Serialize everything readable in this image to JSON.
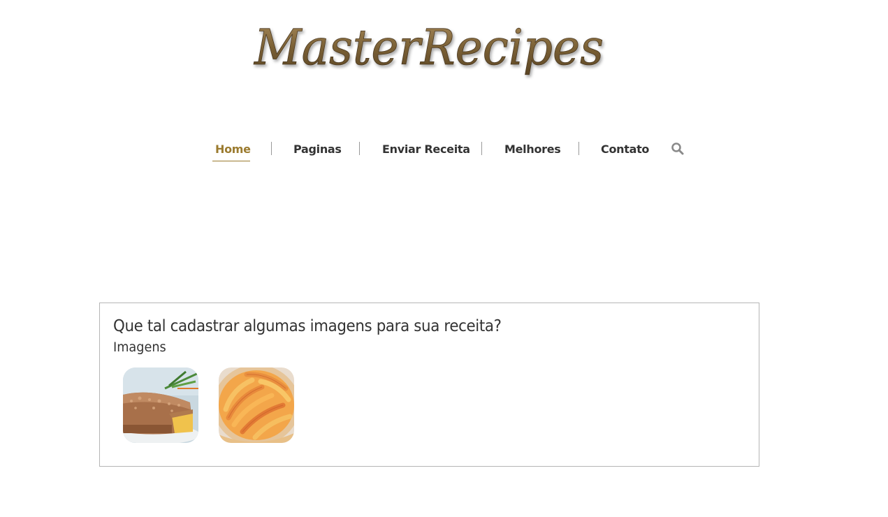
{
  "header": {
    "logo_text": "MasterRecipes"
  },
  "nav": {
    "items": [
      {
        "label": "Home",
        "active": true
      },
      {
        "label": "Paginas",
        "active": false
      },
      {
        "label": "Enviar Receita",
        "active": false
      },
      {
        "label": "Melhores",
        "active": false
      },
      {
        "label": "Contato",
        "active": false
      }
    ],
    "search_icon": "search-icon"
  },
  "colors": {
    "accent": "#9b7b2f",
    "text": "#333333",
    "border": "#b5b5b5"
  },
  "gallery": {
    "title": "Que tal cadastrar algumas imagens para sua receita?",
    "subtitle": "Imagens",
    "images": [
      {
        "name": "crumble-pie-image"
      },
      {
        "name": "peach-tart-image"
      }
    ]
  }
}
